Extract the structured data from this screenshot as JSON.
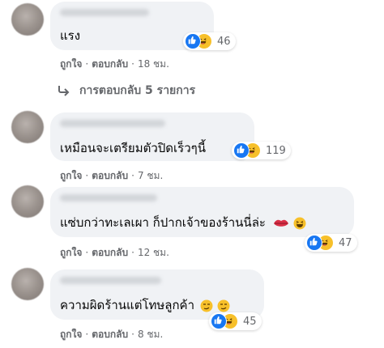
{
  "comments": [
    {
      "text": "แรง",
      "reaction_count": "46",
      "like_label": "ถูกใจ",
      "reply_label": "ตอบกลับ",
      "time": "18 ชม.",
      "replies_label": "การตอบกลับ 5 รายการ"
    },
    {
      "text": "เหมือนจะเตรียมตัวปิดเร็วๆนี้",
      "reaction_count": "119",
      "like_label": "ถูกใจ",
      "reply_label": "ตอบกลับ",
      "time": "7 ชม."
    },
    {
      "text": "แซ่บกว่าทะเลเผา ก็ปากเจ้าของร้านนี่ล่ะ",
      "reaction_count": "47",
      "like_label": "ถูกใจ",
      "reply_label": "ตอบกลับ",
      "time": "12 ชม."
    },
    {
      "text": "ความผิดร้านแต่โทษลูกค้า",
      "reaction_count": "45",
      "like_label": "ถูกใจ",
      "reply_label": "ตอบกลับ",
      "time": "8 ชม."
    }
  ],
  "colors": {
    "bubble": "#f0f2f5",
    "meta_text": "#65676b",
    "like_blue": "#1877f2",
    "haha_yellow": "#f7c02a"
  },
  "icons": [
    "like-reaction-icon",
    "haha-reaction-icon",
    "reply-arrow-icon",
    "lips-emoji-icon",
    "smirk-emoji-icon"
  ]
}
